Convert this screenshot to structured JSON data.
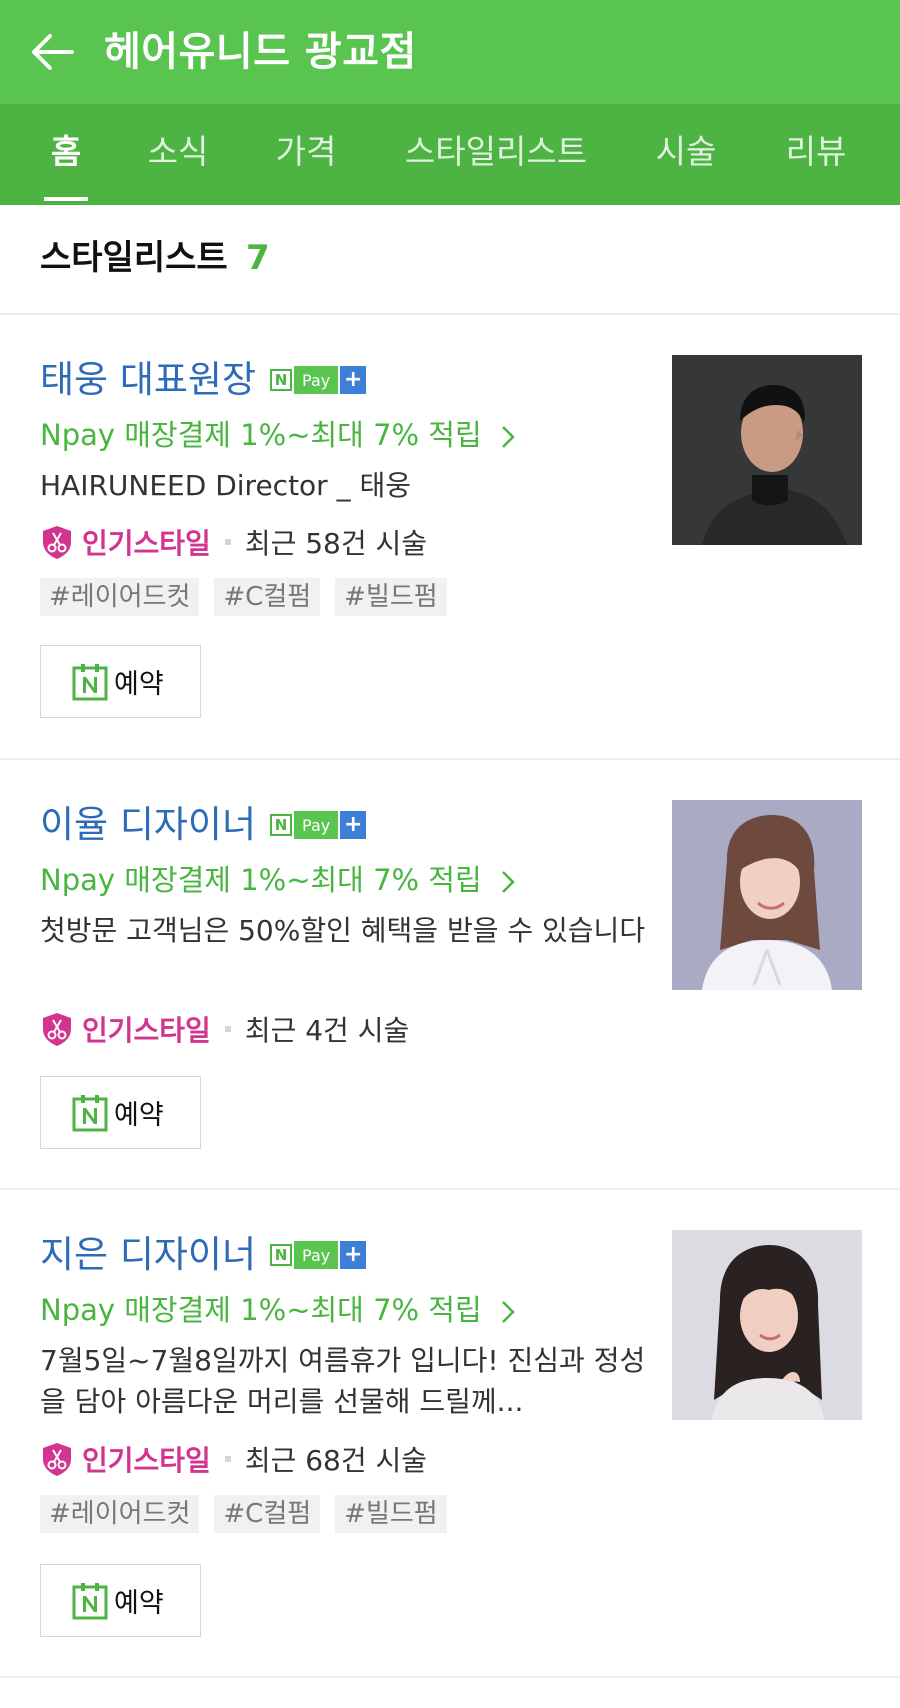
{
  "header": {
    "title": "헤어유니드 광교점"
  },
  "tabs": [
    {
      "label": "홈"
    },
    {
      "label": "소식"
    },
    {
      "label": "가격"
    },
    {
      "label": "스타일리스트"
    },
    {
      "label": "시술"
    },
    {
      "label": "리뷰"
    }
  ],
  "section": {
    "title": "스타일리스트",
    "count": "7"
  },
  "npay_badge": {
    "n": "N",
    "pay": "Pay",
    "plus": "+"
  },
  "stylists": [
    {
      "name": "태웅 대표원장",
      "promo": "Npay 매장결제 1%~최대 7% 적립",
      "desc": "HAIRUNEED Director _ 태웅",
      "popular": "인기스타일",
      "recent": "최근 58건 시술",
      "tags": [
        "#레이어드컷",
        "#C컬펌",
        "#빌드펌"
      ],
      "reserve": "예약"
    },
    {
      "name": "이율 디자이너",
      "promo": "Npay 매장결제 1%~최대 7% 적립",
      "desc": "첫방문 고객님은 50%할인 혜택을 받을 수 있습니다",
      "popular": "인기스타일",
      "recent": "최근 4건 시술",
      "tags": [],
      "reserve": "예약"
    },
    {
      "name": "지은 디자이너",
      "promo": "Npay 매장결제 1%~최대 7% 적립",
      "desc": "7월5일~7월8일까지 여름휴가 입니다! 진심과 정성을 담아 아름다운 머리를 선물해 드릴께...",
      "popular": "인기스타일",
      "recent": "최근 68건 시술",
      "tags": [
        "#레이어드컷",
        "#C컬펌",
        "#빌드펌"
      ],
      "reserve": "예약"
    }
  ],
  "colors": {
    "header_bg": "#5ac451",
    "tabs_bg": "#4db444",
    "name_blue": "#2d6bb8",
    "promo_green": "#48b53f",
    "popular_pink": "#d3348f"
  },
  "icons": {
    "back": "arrow-left-icon",
    "npay": "npay-plus-badge",
    "popular": "scissors-shield-icon",
    "reserve": "naver-calendar-icon",
    "promo": "chevron-right-icon"
  }
}
